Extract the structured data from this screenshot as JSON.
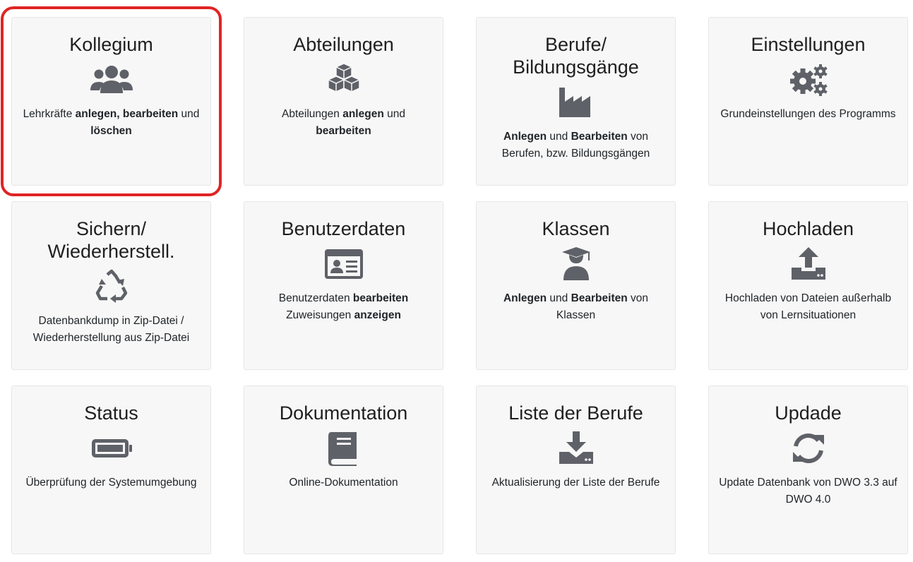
{
  "tiles": [
    {
      "id": "kollegium",
      "title": "Kollegium",
      "icon": "users-icon",
      "selected": true,
      "desc": [
        {
          "t": "Lehrkräfte "
        },
        {
          "t": "anlegen, bearbeiten",
          "b": true
        },
        {
          "t": " und "
        },
        {
          "t": "löschen",
          "b": true
        }
      ]
    },
    {
      "id": "abteilungen",
      "title": "Abteilungen",
      "icon": "cubes-icon",
      "desc": [
        {
          "t": "Abteilungen "
        },
        {
          "t": "anlegen",
          "b": true
        },
        {
          "t": " und "
        },
        {
          "t": "bearbeiten",
          "b": true
        }
      ]
    },
    {
      "id": "berufe",
      "title": "Berufe/\nBildungsgänge",
      "icon": "industry-icon",
      "desc": [
        {
          "t": "Anlegen",
          "b": true
        },
        {
          "t": " und "
        },
        {
          "t": "Bearbeiten",
          "b": true
        },
        {
          "t": " von Berufen, bzw. Bildungsgängen"
        }
      ]
    },
    {
      "id": "einstellungen",
      "title": "Einstellungen",
      "icon": "cogs-icon",
      "desc": [
        {
          "t": "Grundeinstellungen des Programms"
        }
      ]
    },
    {
      "id": "sichern",
      "title": "Sichern/\nWiederherstell.",
      "icon": "recycle-icon",
      "desc": [
        {
          "t": "Datenbankdump in Zip-Datei / Wiederherstellung aus Zip-Datei"
        }
      ]
    },
    {
      "id": "benutzerdaten",
      "title": "Benutzerdaten",
      "icon": "id-card-icon",
      "desc": [
        {
          "t": "Benutzerdaten "
        },
        {
          "t": "bearbeiten",
          "b": true
        },
        {
          "t": " Zuweisungen "
        },
        {
          "t": "anzeigen",
          "b": true
        }
      ]
    },
    {
      "id": "klassen",
      "title": "Klassen",
      "icon": "graduate-icon",
      "desc": [
        {
          "t": "Anlegen",
          "b": true
        },
        {
          "t": " und "
        },
        {
          "t": "Bearbeiten",
          "b": true
        },
        {
          "t": " von Klassen"
        }
      ]
    },
    {
      "id": "hochladen",
      "title": "Hochladen",
      "icon": "upload-icon",
      "desc": [
        {
          "t": "Hochladen von Dateien außerhalb von Lernsituationen"
        }
      ]
    },
    {
      "id": "status",
      "title": "Status",
      "icon": "battery-icon",
      "desc": [
        {
          "t": "Überprüfung der Systemumgebung"
        }
      ]
    },
    {
      "id": "dokumentation",
      "title": "Dokumentation",
      "icon": "book-icon",
      "desc": [
        {
          "t": "Online-Dokumentation"
        }
      ]
    },
    {
      "id": "liste-der-berufe",
      "title": "Liste der Berufe",
      "icon": "download-icon",
      "desc": [
        {
          "t": "Aktualisierung der Liste der Berufe"
        }
      ]
    },
    {
      "id": "updade",
      "title": "Updade",
      "icon": "sync-icon",
      "desc": [
        {
          "t": "Update Datenbank von DWO 3.3 auf DWO 4.0"
        }
      ]
    }
  ],
  "colors": {
    "icon": "#5f6168",
    "highlight": "#e02424",
    "tile_bg": "#f7f7f7"
  }
}
